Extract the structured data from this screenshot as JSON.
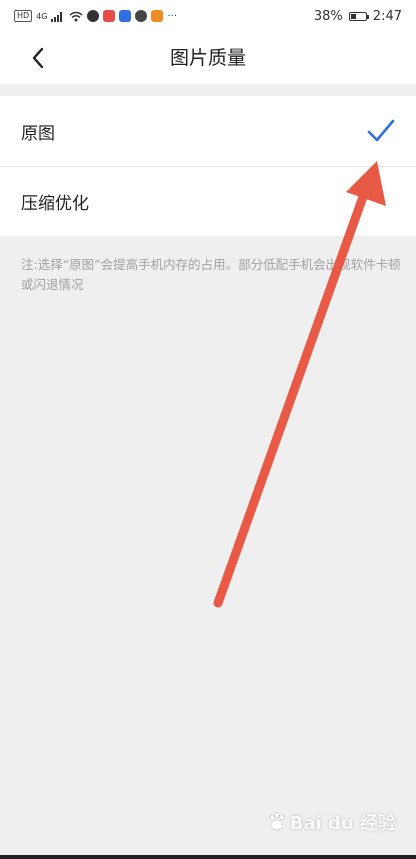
{
  "status_bar": {
    "network_badge": "HD",
    "signal_label": "4G",
    "app_icons": [
      {
        "name": "message-icon",
        "color": "#333333"
      },
      {
        "name": "app-icon-red",
        "color": "#e94a4a"
      },
      {
        "name": "app-icon-blue",
        "color": "#2f6fe0"
      },
      {
        "name": "app-icon-dark",
        "color": "#444444"
      },
      {
        "name": "app-icon-orange",
        "color": "#f08a24"
      }
    ],
    "more_indicator": "···",
    "battery_percent": "38%",
    "battery_level": 0.38,
    "time": "2:47"
  },
  "nav": {
    "back_icon": "chevron-left-icon",
    "title": "图片质量"
  },
  "options": [
    {
      "label": "原图",
      "selected": true
    },
    {
      "label": "压缩优化",
      "selected": false
    }
  ],
  "note": "注:选择“原图”会提高手机内存的占用。部分低配手机会出现软件卡顿或闪退情况",
  "accent_color": "#2f6fe0",
  "annotation_color": "#e85a45",
  "watermark": {
    "text": "Bai du 经验"
  }
}
